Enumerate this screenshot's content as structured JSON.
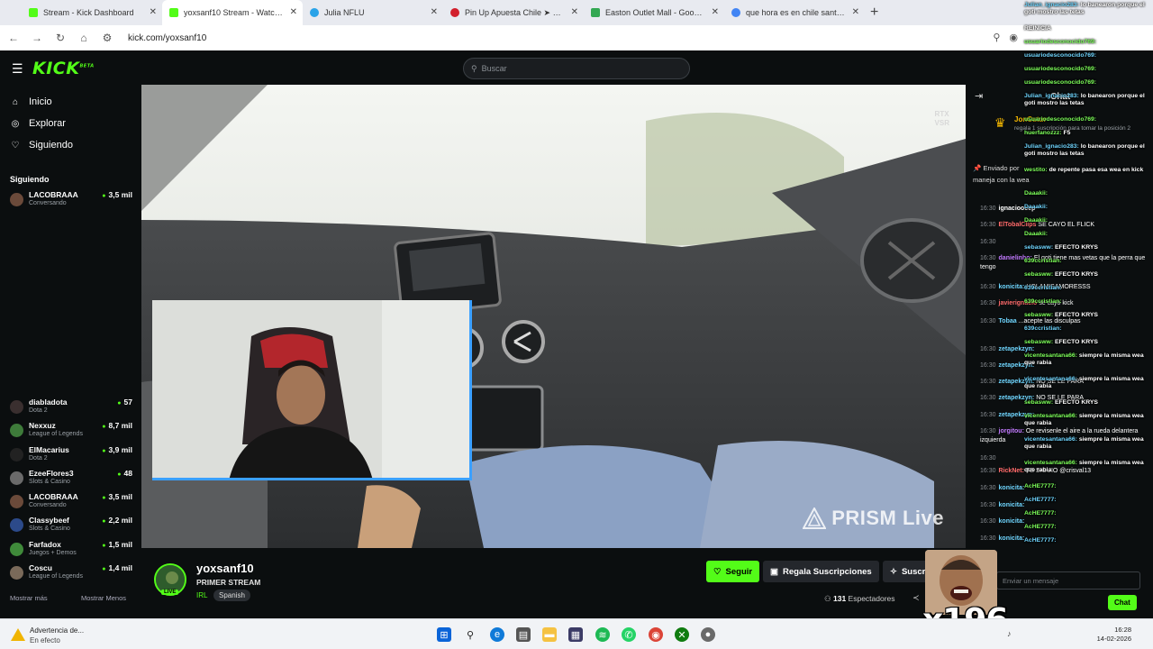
{
  "browser": {
    "tabs": [
      {
        "title": "Stream - Kick Dashboard",
        "color": "#53fc18"
      },
      {
        "title": "yoxsanf10 Stream - Watch L",
        "color": "#53fc18"
      },
      {
        "title": "Julia NFLU",
        "color": "#2aa3e8"
      },
      {
        "title": "Pin Up Apuesta Chile ➤ Libro D",
        "color": "#d21f2c"
      },
      {
        "title": "Easton Outlet Mall - Google M",
        "color": "#34a853"
      },
      {
        "title": "que hora es en chile santiago",
        "color": "#4285f4"
      }
    ],
    "url": "kick.com/yoxsanf10"
  },
  "header": {
    "logo": "KICK",
    "logo_beta": "BETA",
    "search_placeholder": "Buscar"
  },
  "sidebar": {
    "nav": [
      {
        "label": "Inicio",
        "icon": "home-icon"
      },
      {
        "label": "Explorar",
        "icon": "compass-icon"
      },
      {
        "label": "Siguiendo",
        "icon": "heart-icon"
      }
    ],
    "following_title": "Siguiendo",
    "channels": [
      {
        "name": "LACOBRAAA",
        "category": "Conversando",
        "viewers": "3,5 mil"
      },
      {
        "name": "diabladota",
        "category": "Dota 2",
        "viewers": "57"
      },
      {
        "name": "Nexxuz",
        "category": "League of Legends",
        "viewers": "8,7 mil"
      },
      {
        "name": "ElMacarius",
        "category": "Dota 2",
        "viewers": "3,9 mil"
      },
      {
        "name": "EzeeFlores3",
        "category": "Slots & Casino",
        "viewers": "48"
      },
      {
        "name": "LACOBRAAA",
        "category": "Conversando",
        "viewers": "3,5 mil"
      },
      {
        "name": "Classybeef",
        "category": "Slots & Casino",
        "viewers": "2,2 mil"
      },
      {
        "name": "Farfadox",
        "category": "Juegos + Demos",
        "viewers": "1,5 mil"
      },
      {
        "name": "Coscu",
        "category": "League of Legends",
        "viewers": "1,4 mil"
      }
    ],
    "show_more": "Mostrar más",
    "show_less": "Mostrar Menos"
  },
  "video": {
    "rtx_line1": "RTX",
    "rtx_line2": "VSR",
    "watermark": "PRISM Live"
  },
  "stream": {
    "streamer": "yoxsanf10",
    "title": "PRIMER STREAM",
    "category": "IRL",
    "language": "Spanish",
    "live_badge": "LIVE",
    "follow_label": "Seguir",
    "gift_label": "Regala Suscripciones",
    "sub_label": "Suscribirse",
    "viewers_count": "131",
    "viewers_label": "Espectadores"
  },
  "chat": {
    "title": "Chat",
    "pinned_user": "JonCutur",
    "pinned_text": "regala 1 suscripción para tomar la posición 2",
    "sent_by": "Enviado por",
    "sent_text": "maneja con la wea",
    "messages": [
      {
        "time": "16:30",
        "user": "ignacioocep",
        "text": "",
        "color": "#ffffff"
      },
      {
        "time": "16:30",
        "user": "ElTobalClips",
        "text": "SE CAYO EL FLICK",
        "color": "#ff6a6a"
      },
      {
        "time": "16:30",
        "user": "",
        "text": "",
        "color": "#ffffff"
      },
      {
        "time": "16:30",
        "user": "danielinho:",
        "text": "El goti tiene mas vetas que la perra que tengo",
        "color": "#c27aff"
      },
      {
        "time": "16:30",
        "user": "konicita:",
        "text": "HOLAMISAMORESSS",
        "color": "#6fd6ff"
      },
      {
        "time": "16:30",
        "user": "javierignacio",
        "text": "se cayo kick",
        "color": "#ff6a6a"
      },
      {
        "time": "16:30",
        "user": "Tobaa",
        "text": "...acepte las disculpas",
        "color": "#6fd6ff"
      },
      {
        "time": "16:30",
        "user": "zetapekzyn:",
        "text": "",
        "color": "#6fd6ff"
      },
      {
        "time": "16:30",
        "user": "zetapekzyn:",
        "text": "",
        "color": "#6fd6ff"
      },
      {
        "time": "16:30",
        "user": "zetapekzyn:",
        "text": "NO SE LE PARA",
        "color": "#6fd6ff"
      },
      {
        "time": "16:30",
        "user": "zetapekzyn:",
        "text": "NO SE LE PARA",
        "color": "#6fd6ff"
      },
      {
        "time": "16:30",
        "user": "zetapekzyn:",
        "text": "",
        "color": "#6fd6ff"
      },
      {
        "time": "16:30",
        "user": "jorgitou:",
        "text": "Oe revisenle el aire a la rueda delantera izquierda",
        "color": "#c27aff"
      },
      {
        "time": "16:30",
        "user": "",
        "text": "",
        "color": "#ffffff"
      },
      {
        "time": "16:30",
        "user": "RickNet:",
        "text": "TE SIGUIO @crisval13",
        "color": "#ff6a6a"
      },
      {
        "time": "16:30",
        "user": "konicita:",
        "text": "",
        "color": "#6fd6ff"
      },
      {
        "time": "16:30",
        "user": "konicita:",
        "text": "",
        "color": "#6fd6ff"
      },
      {
        "time": "16:30",
        "user": "konicita:",
        "text": "",
        "color": "#6fd6ff"
      },
      {
        "time": "16:30",
        "user": "konicita:",
        "text": "",
        "color": "#6fd6ff"
      }
    ],
    "input_placeholder": "Enviar un mensaje",
    "send_label": "Chat"
  },
  "overlay_chat": [
    {
      "user": "Julian_ignacio283:",
      "text": "lo banearon porque el goti mostro las tetas"
    },
    {
      "user": "",
      "text": "REINICIA"
    },
    {
      "user": "usuariodesconocido769:",
      "text": ""
    },
    {
      "user": "usuariodesconocido769:",
      "text": ""
    },
    {
      "user": "usuariodesconocido769:",
      "text": ""
    },
    {
      "user": "usuariodesconocido769:",
      "text": ""
    },
    {
      "user": "Julian_ignacio283:",
      "text": "lo banearon porque el goti mostro las tetas"
    },
    {
      "user": "usuariodesconocido769:",
      "text": ""
    },
    {
      "user": "huerfanozzz:",
      "text": "F5"
    },
    {
      "user": "Julian_ignacio283:",
      "text": "lo banearon porque el goti mostro las tetas"
    },
    {
      "user": "westito:",
      "text": "de repente pasa esa wea en kick"
    },
    {
      "user": "Daaakii:",
      "text": ""
    },
    {
      "user": "Daaakii:",
      "text": ""
    },
    {
      "user": "Daaakii:",
      "text": ""
    },
    {
      "user": "Daaakii:",
      "text": ""
    },
    {
      "user": "sebasww:",
      "text": "EFECTO KRYS"
    },
    {
      "user": "639ccristian:",
      "text": ""
    },
    {
      "user": "sebasww:",
      "text": "EFECTO KRYS"
    },
    {
      "user": "639ccristian:",
      "text": ""
    },
    {
      "user": "639ccristian:",
      "text": ""
    },
    {
      "user": "sebasww:",
      "text": "EFECTO KRYS"
    },
    {
      "user": "639ccristian:",
      "text": ""
    },
    {
      "user": "sebasww:",
      "text": "EFECTO KRYS"
    },
    {
      "user": "vicentesantana66:",
      "text": "siempre la misma wea que rabia"
    },
    {
      "user": "vicentesantana66:",
      "text": "siempre la misma wea que rabia"
    },
    {
      "user": "sebasww:",
      "text": "EFECTO KRYS"
    },
    {
      "user": "vicentesantana66:",
      "text": "siempre la misma wea que rabia"
    },
    {
      "user": "vicentesantana66:",
      "text": "siempre la misma wea que rabia"
    },
    {
      "user": "vicentesantana66:",
      "text": "siempre la misma wea que rabia"
    },
    {
      "user": "AcHE7777:",
      "text": ""
    },
    {
      "user": "AcHE7777:",
      "text": ""
    },
    {
      "user": "AcHE7777:",
      "text": ""
    },
    {
      "user": "AcHE7777:",
      "text": ""
    },
    {
      "user": "AcHE7777:",
      "text": ""
    }
  ],
  "meme": {
    "count": "x196"
  },
  "taskbar": {
    "weather_line1": "Advertencia de...",
    "weather_line2": "En efecto",
    "time": "16:28",
    "date": "14-02-2026"
  }
}
